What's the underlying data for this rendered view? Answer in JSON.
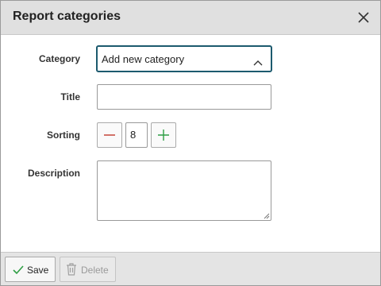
{
  "dialog": {
    "title": "Report categories"
  },
  "form": {
    "category": {
      "label": "Category",
      "value": "Add new category"
    },
    "title": {
      "label": "Title",
      "value": ""
    },
    "sorting": {
      "label": "Sorting",
      "value": "8"
    },
    "description": {
      "label": "Description",
      "value": ""
    }
  },
  "footer": {
    "save_label": "Save",
    "delete_label": "Delete"
  },
  "icons": {
    "close": "close-icon",
    "chevron": "chevron-up-icon",
    "minus": "minus-icon",
    "plus": "plus-icon",
    "save": "check-icon",
    "delete": "trash-icon"
  },
  "colors": {
    "accent": "#1c5a6e",
    "minus": "#c0392b",
    "plus": "#2e9e44",
    "save_check": "#2e9e44"
  }
}
